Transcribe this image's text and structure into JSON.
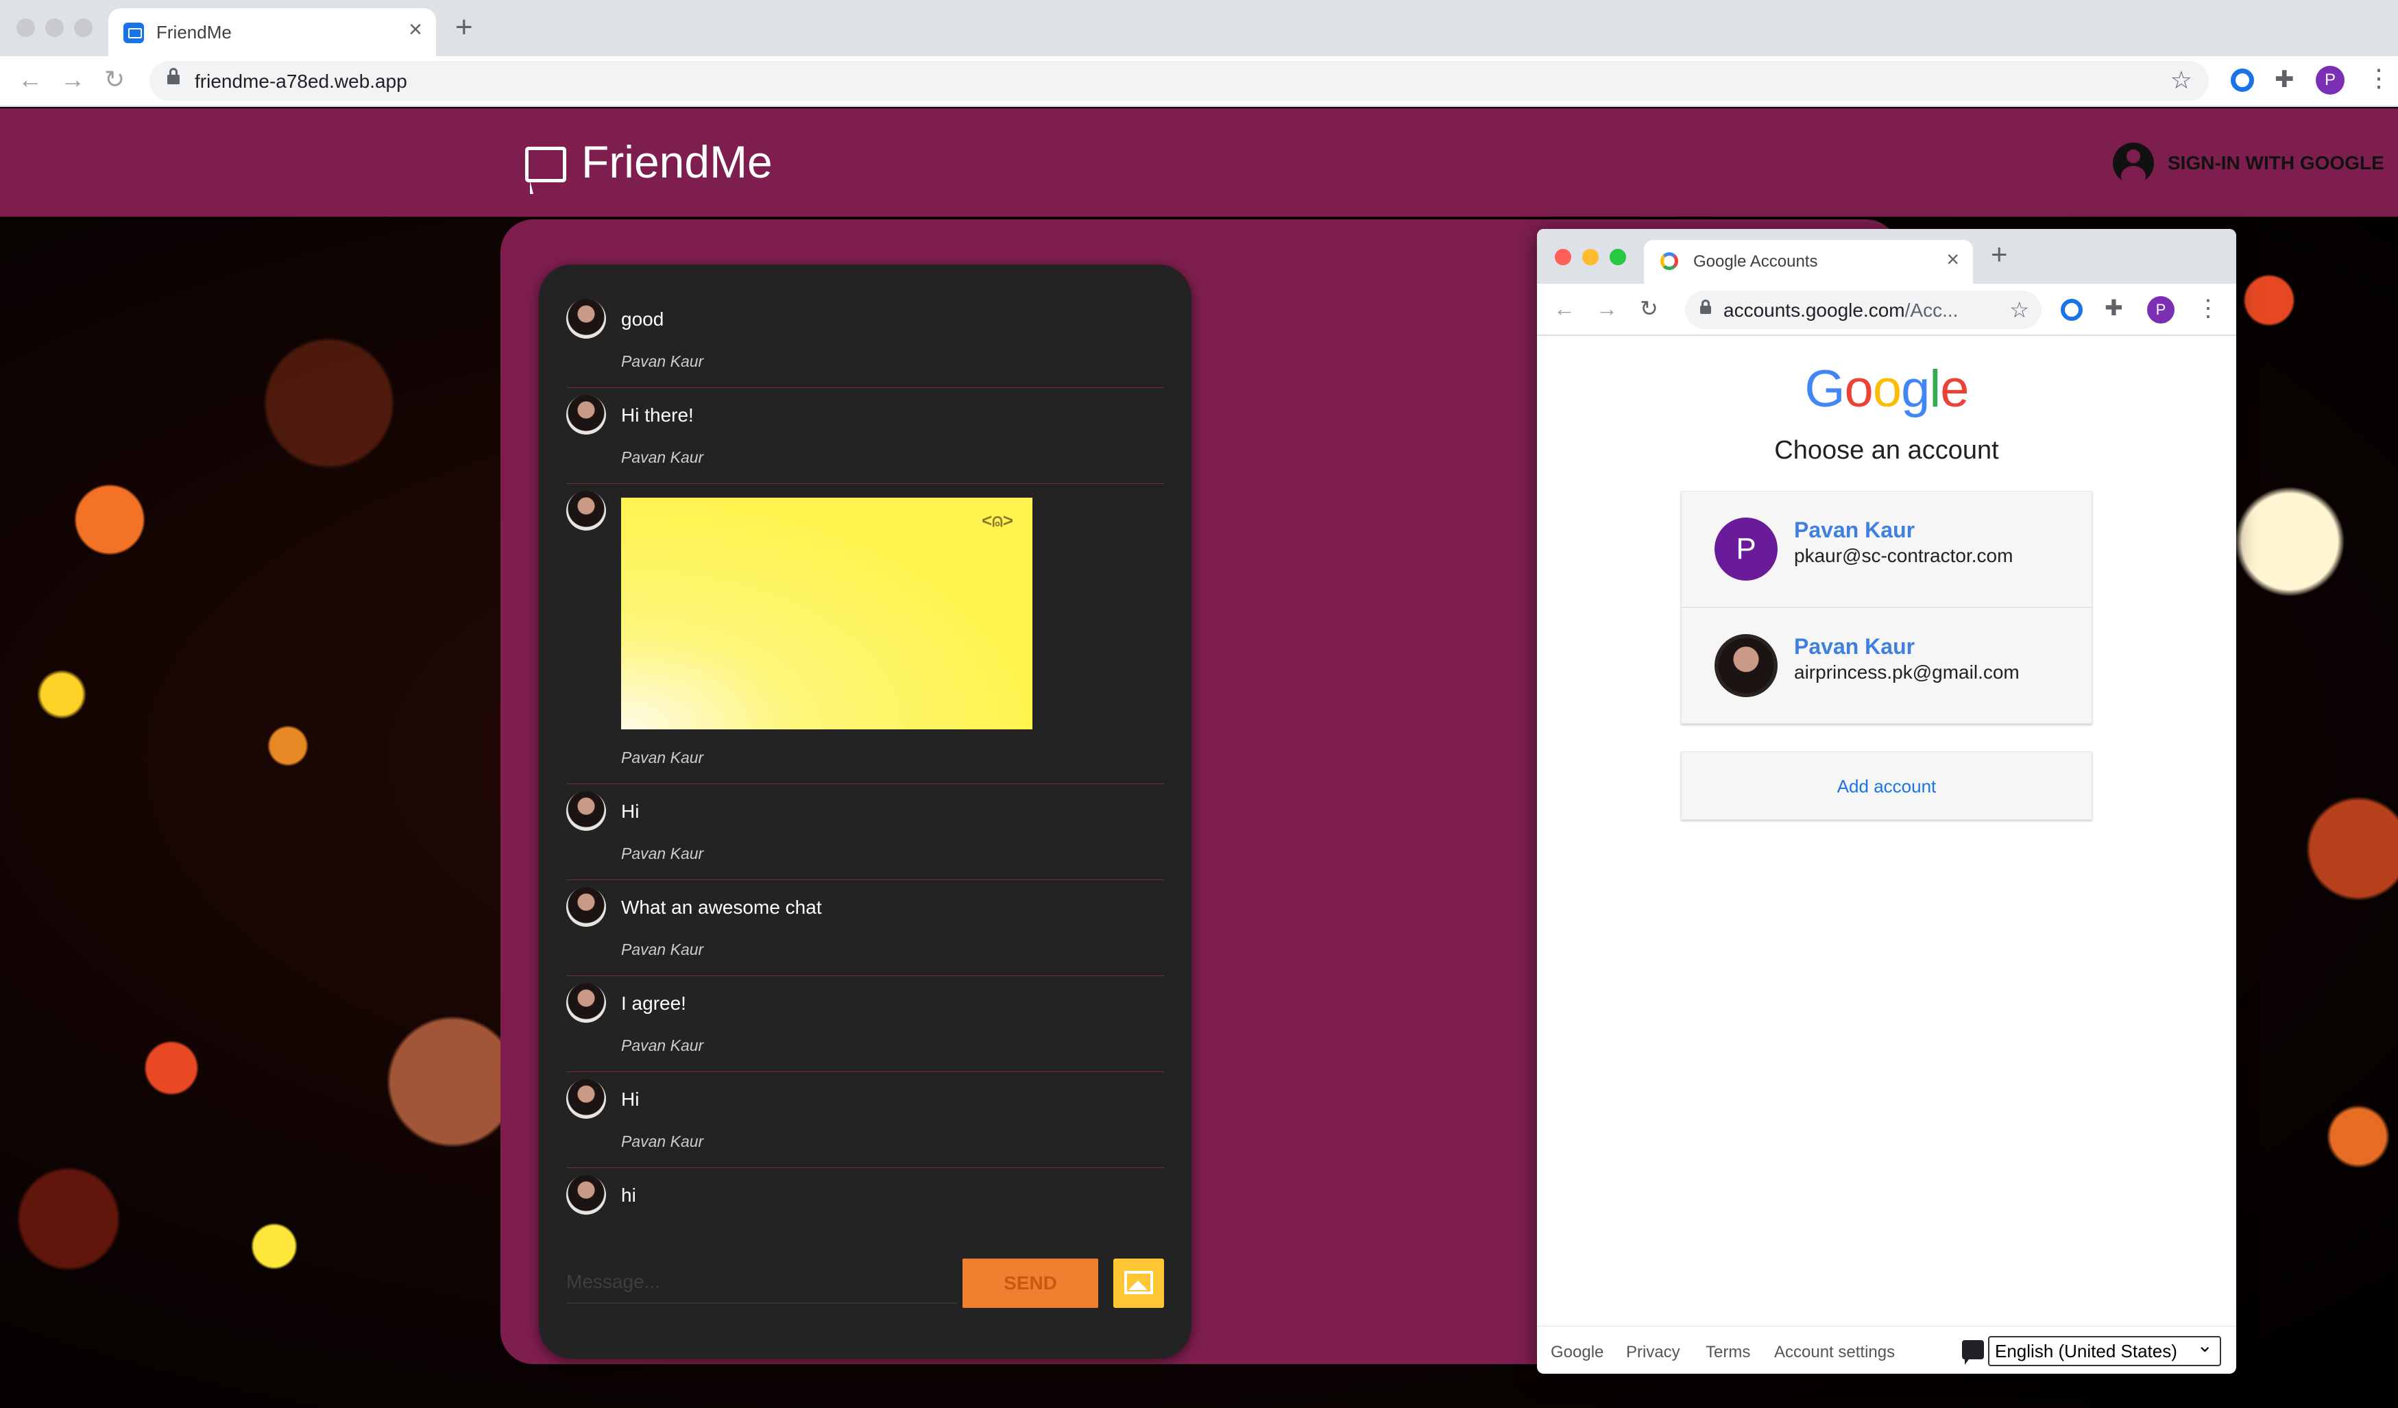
{
  "browser": {
    "tab_title": "FriendMe",
    "url": "friendme-a78ed.web.app",
    "profile_initial": "P"
  },
  "app": {
    "title": "FriendMe",
    "signin_label": "SIGN-IN WITH GOOGLE"
  },
  "chat": {
    "messages": [
      {
        "text": "good",
        "author": "Pavan Kaur"
      },
      {
        "text": "Hi there!",
        "author": "Pavan Kaur"
      },
      {
        "image": true,
        "image_text": "<⍝>",
        "author": "Pavan Kaur"
      },
      {
        "text": "Hi",
        "author": "Pavan Kaur"
      },
      {
        "text": "What an awesome chat",
        "author": "Pavan Kaur"
      },
      {
        "text": "I agree!",
        "author": "Pavan Kaur"
      },
      {
        "text": "Hi",
        "author": "Pavan Kaur"
      },
      {
        "text": "hi",
        "author": ""
      }
    ],
    "input_placeholder": "Message...",
    "send_label": "SEND"
  },
  "popup": {
    "tab_title": "Google Accounts",
    "url_host": "accounts.google.com",
    "url_path": "/Acc...",
    "profile_initial": "P",
    "logo_letters": [
      "G",
      "o",
      "o",
      "g",
      "l",
      "e"
    ],
    "logo_colors": [
      "#4285f4",
      "#ea4335",
      "#fbbc05",
      "#4285f4",
      "#34a853",
      "#ea4335"
    ],
    "heading": "Choose an account",
    "accounts": [
      {
        "initial": "P",
        "name": "Pavan Kaur",
        "email": "pkaur@sc-contractor.com"
      },
      {
        "name": "Pavan Kaur",
        "email": "airprincess.pk@gmail.com"
      }
    ],
    "add_account": "Add account",
    "footer": {
      "links": [
        "Google",
        "Privacy",
        "Terms",
        "Account settings"
      ],
      "language": "English (United States)"
    }
  }
}
